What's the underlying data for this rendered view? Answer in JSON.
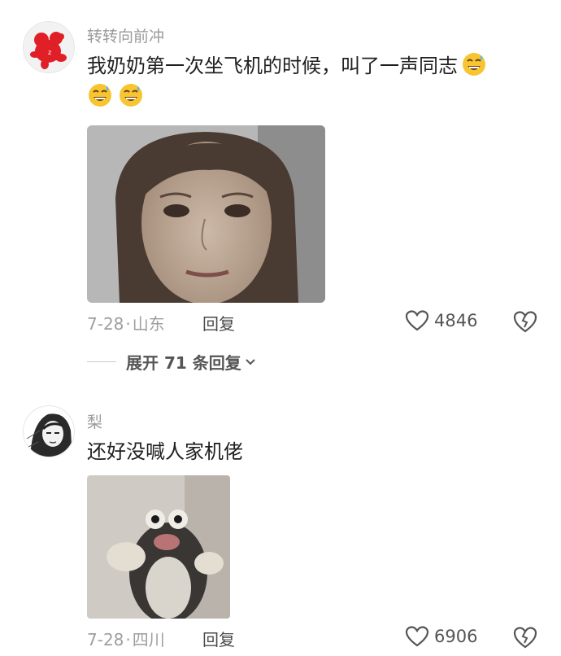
{
  "comments": [
    {
      "username": "转转向前冲",
      "text": "我奶奶第一次坐飞机的时候，叫了一声同志",
      "date": "7-28",
      "location": "山东",
      "reply_label": "回复",
      "likes": "4846",
      "expand_label": "展开 71 条回复"
    },
    {
      "username": "梨",
      "text": "还好没喊人家机佬",
      "date": "7-28",
      "location": "四川",
      "reply_label": "回复",
      "likes": "6906"
    }
  ],
  "meta_separator": "·",
  "icons": {
    "emoji": "grinning-sweat-emoji",
    "like": "heart-outline-icon",
    "dislike": "broken-heart-icon",
    "expand": "chevron-down-icon"
  },
  "colors": {
    "text": "#1f1f1f",
    "muted": "#9a9a9a",
    "emoji_face": "#f7c531"
  }
}
